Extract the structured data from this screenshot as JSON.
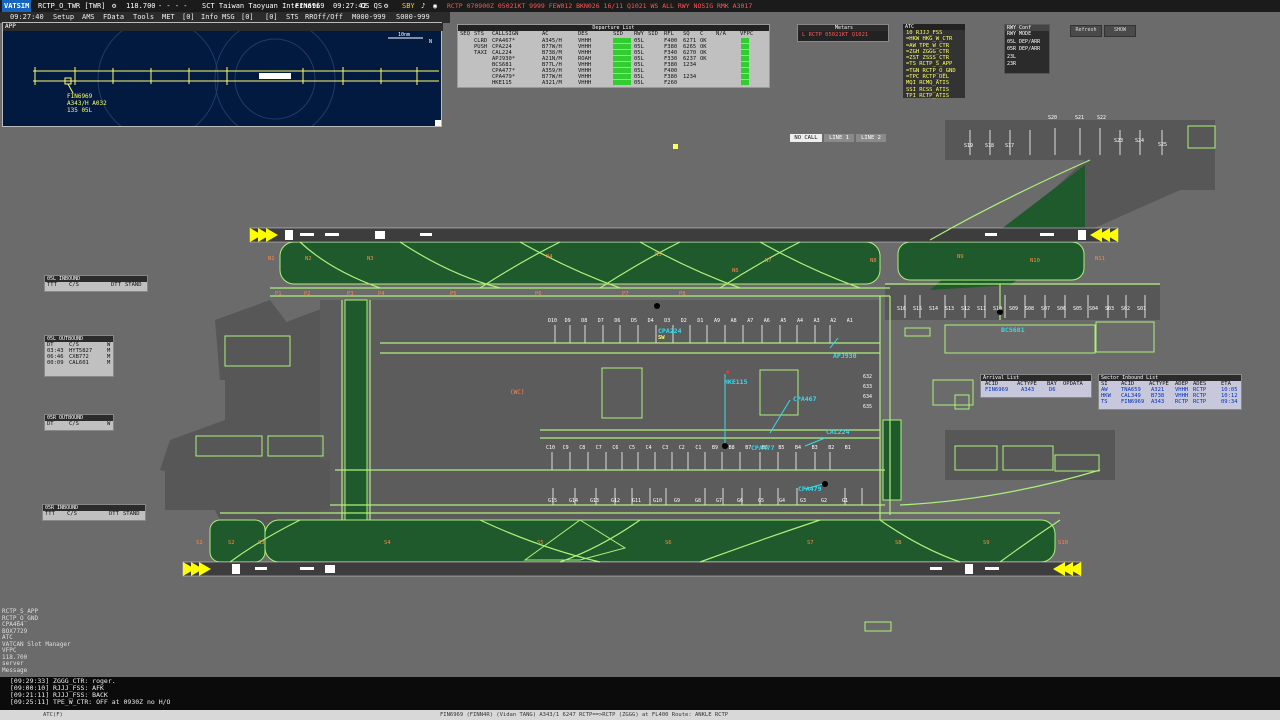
{
  "topbar": {
    "vatsim": "VATSIM",
    "position": "RCTP_O_TWR [TWR]",
    "freq": "118.700",
    "dashes": "- - - -",
    "sector": "SCT Taiwan Taoyuan Internati",
    "callsign": "FIN6969",
    "time": "09:27:42",
    "os_qs": "OS QS",
    "sby": "SBY",
    "metar": "RCTP 070900Z 05021KT 9999 FEW012 BKN026 16/11 Q1021 WS ALL RWY NOSIG RMK A3017"
  },
  "menubar": {
    "clock": "09:27:40",
    "items": [
      "Setup",
      "AMS",
      "FData",
      "Tools",
      "MET",
      "[0]",
      "Info",
      "MSG",
      "[0]",
      "[0]",
      "STS",
      "RROff/Off",
      "M000-999",
      "S000-999"
    ]
  },
  "app_window": {
    "title": "APP",
    "range": "10nm",
    "north": "N",
    "label_lines": [
      "FIN6969",
      "A343/H A032",
      "135 05L"
    ]
  },
  "departure_list": {
    "title": "Departure List",
    "headers": [
      "SEQ",
      "STS",
      "CALLSIGN",
      "AC",
      "DES",
      "SID",
      "RWY",
      "SID",
      "RFL",
      "SQ",
      "C",
      "N/A",
      "VFPC"
    ],
    "rows": [
      {
        "sts": "CLRD",
        "cs": "CPA467*",
        "ac": "A345/H",
        "des": "VHHH",
        "rwy": "05L",
        "rfl": "F400",
        "sq": "6271",
        "c": "OK"
      },
      {
        "sts": "PUSH",
        "cs": "CPA224",
        "ac": "B77W/H",
        "des": "VHHH",
        "rwy": "05L",
        "rfl": "F380",
        "sq": "6265",
        "c": "OK"
      },
      {
        "sts": "TAXI",
        "cs": "CAL224",
        "ac": "B738/M",
        "des": "VHHH",
        "rwy": "05L",
        "rfl": "F340",
        "sq": "6270",
        "c": "OK"
      },
      {
        "sts": "",
        "cs": "APJ930*",
        "ac": "A21N/M",
        "des": "ROAH",
        "rwy": "05L",
        "rfl": "F330",
        "sq": "6237",
        "c": "OK"
      },
      {
        "sts": "",
        "cs": "BCS681",
        "ac": "B77L/H",
        "des": "VHHH",
        "rwy": "05L",
        "rfl": "F380",
        "sq": "1234",
        "c": ""
      },
      {
        "sts": "",
        "cs": "CPA477*",
        "ac": "A359/H",
        "des": "VHHH",
        "rwy": "05L",
        "rfl": "F400",
        "sq": "",
        "c": ""
      },
      {
        "sts": "",
        "cs": "CPA479*",
        "ac": "B77W/H",
        "des": "VHHH",
        "rwy": "05L",
        "rfl": "F380",
        "sq": "1234",
        "c": ""
      },
      {
        "sts": "",
        "cs": "HKE115",
        "ac": "A321/M",
        "des": "VHHH",
        "rwy": "05L",
        "rfl": "F260",
        "sq": "",
        "c": ""
      }
    ]
  },
  "metar_panel": {
    "title": "Metars",
    "line": "L RCTP 05021KT Q1021"
  },
  "atc_list": {
    "title": "ATC",
    "items": [
      "10 RJJJ_FSS",
      "=HKW HKG_W_CTR",
      "=AW TPE_W_CTR",
      "=ZGH ZGGG_CTR",
      "=ZST ZSSS_CTR",
      "=TS RCTP_S_APP",
      "=TGN RCTP_O_GND",
      "=TPC RCTP_DEL",
      "MQI RCMQ_ATIS",
      "SSI RCSS_ATIS",
      "TPI RCTP_ATIS"
    ]
  },
  "rwy_conf": {
    "title": "RWY Conf",
    "rows": [
      "RWY MODE",
      "05L DEP/ARR",
      "05R DEP/ARR",
      "23L",
      "23R"
    ],
    "refresh": "Refresh",
    "show": "SHOW"
  },
  "line_buttons": {
    "nocall": "NO CALL",
    "line1": "LINE 1",
    "line2": "LINE 2"
  },
  "inbound_05l": {
    "title": "05L INBOUND",
    "cols": [
      "TTT",
      "C/S",
      "DTT",
      "STAND"
    ]
  },
  "outbound_05l": {
    "title": "05L OUTBOUND",
    "cols": [
      "DT",
      "C/S",
      "W"
    ],
    "rows": [
      {
        "dt": "03:43",
        "cs": "HYT5827",
        "w": "M"
      },
      {
        "dt": "06:46",
        "cs": "CXB772",
        "w": "M"
      },
      {
        "dt": "00:09",
        "cs": "CAL601",
        "w": "M"
      }
    ]
  },
  "outbound_05r": {
    "title": "05R OUTBOUND",
    "cols": [
      "DT",
      "C/S",
      "W"
    ]
  },
  "inbound_05r": {
    "title": "05R INBOUND",
    "cols": [
      "TTT",
      "C/S",
      "DTT",
      "STAND"
    ]
  },
  "arrival_list": {
    "title": "Arrival List",
    "cols": [
      "ACID",
      "ACTYPE",
      "BAY",
      "OPDATA"
    ],
    "rows": [
      {
        "acid": "FIN6969",
        "type": "A343",
        "bay": "D6",
        "op": ""
      }
    ]
  },
  "sector_list": {
    "title": "Sector Inbound List",
    "cols": [
      "SI",
      "ACID",
      "ACTYPE",
      "ADEP",
      "ADES",
      "ETA"
    ],
    "rows": [
      {
        "si": "AW",
        "acid": "TNA659",
        "type": "A321",
        "adep": "VHHH",
        "ades": "RCTP",
        "eta": "10:05"
      },
      {
        "si": "HKW",
        "acid": "CAL349",
        "type": "B738",
        "adep": "VHHH",
        "ades": "RCTP",
        "eta": "10:12"
      },
      {
        "si": "TS",
        "acid": "FIN6969",
        "type": "A343",
        "adep": "RCTP",
        "ades": "RCTP",
        "eta": "09:34"
      }
    ]
  },
  "aircraft_labels": [
    {
      "cs": "CPA224",
      "sub": "SW",
      "color": "#33ddee"
    },
    {
      "cs": "APJ930",
      "sub": "",
      "color": "#33ddee"
    },
    {
      "cs": "HKE115",
      "sub": "",
      "color": "#33ddee"
    },
    {
      "cs": "CPA467",
      "sub": "",
      "color": "#33ddee"
    },
    {
      "cs": "CAL224",
      "sub": "",
      "color": "#33ddee"
    },
    {
      "cs": "CPA477",
      "sub": "",
      "color": "#33ddee"
    },
    {
      "cs": "CPA479",
      "sub": "",
      "color": "#33ddee"
    },
    {
      "cs": "BCS681",
      "sub": "",
      "color": "#33ddee"
    }
  ],
  "map_labels": {
    "wc": "(WC)",
    "taxiways_north": [
      "N1",
      "N2",
      "N3",
      "N4",
      "N5",
      "N6",
      "N7",
      "N8",
      "N9",
      "N10",
      "N11"
    ],
    "taxiways_p": [
      "P1",
      "P2",
      "P3",
      "P4",
      "P5",
      "P6",
      "P7",
      "P8"
    ],
    "taxiways_south": [
      "S1",
      "S2",
      "S3",
      "S4",
      "S5",
      "S6",
      "S7",
      "S8",
      "S9",
      "S10"
    ],
    "stands_d": [
      "D10",
      "D9",
      "D8",
      "D7",
      "D6",
      "D5",
      "D4",
      "D3",
      "D2",
      "D1",
      "A9",
      "A8",
      "A7",
      "A6",
      "A5",
      "A4",
      "A3",
      "A2",
      "A1"
    ],
    "stands_c": [
      "C10",
      "C9",
      "C8",
      "C7",
      "C6",
      "C5",
      "C4",
      "C3",
      "C2",
      "C1",
      "B9",
      "B8",
      "B7",
      "B6",
      "B5",
      "B4",
      "B3",
      "B2",
      "B1"
    ],
    "stands_g": [
      "G15",
      "G14",
      "G13",
      "G12",
      "G11",
      "G10",
      "G9",
      "G8",
      "G7",
      "G6",
      "G5",
      "G4",
      "G3",
      "G2",
      "G1"
    ],
    "stands_e": [
      "S16",
      "S15",
      "S14",
      "S13",
      "S12",
      "S11",
      "S10",
      "S09",
      "S08",
      "S07",
      "S06",
      "S05",
      "S04",
      "S03",
      "S02",
      "S01"
    ],
    "stands_top": [
      "S20",
      "S21",
      "S22",
      "S19",
      "S18",
      "S17",
      "S23",
      "S24",
      "S25"
    ],
    "remote": [
      "632",
      "633",
      "634",
      "635"
    ]
  },
  "chat": {
    "controllers": [
      "RCTP_S_APP",
      "RCTP_O_GND",
      "CPA464",
      "BOX7729",
      "ATC",
      "VATCAN Slot Manager",
      "VFPC",
      "118.700",
      "server",
      "Message"
    ],
    "messages": [
      "[09:29:33] ZGGG_CTR: roger.",
      "[09:00:10] RJJJ_FSS: AFK",
      "[09:21:11] RJJJ_FSS: BACK",
      "[09:25:11] TPE_W_CTR: OFF at 0930Z no H/O"
    ]
  },
  "statusbar": {
    "left": "ATC(F)",
    "center": "FIN6969 (FINN4R) (Vidan TANG) A343/1 6247 RCTP==>RCTP (ZGGG) at FL400 Route: ANKLE RCTP"
  },
  "colors": {
    "grass": "#1f5a2c",
    "apron": "#575757",
    "taxiline": "#aef07a",
    "background": "#6b6b6b",
    "label": "#33ddee",
    "orange": "#ff8844"
  }
}
